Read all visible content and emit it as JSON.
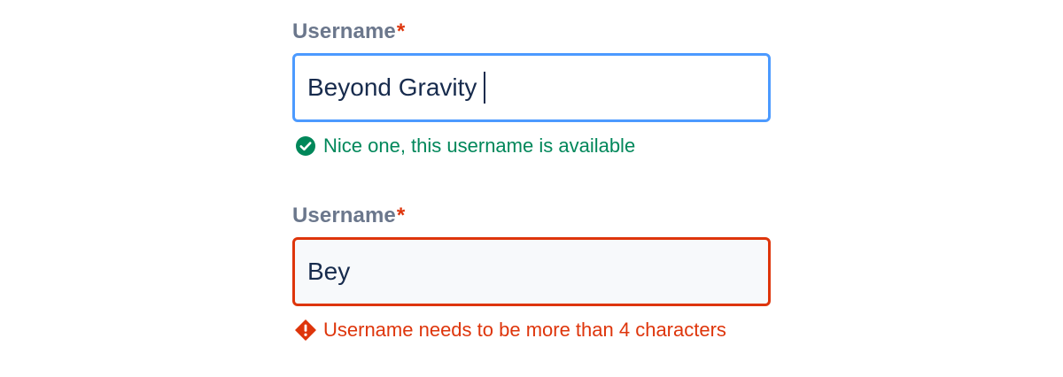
{
  "fields": [
    {
      "label": "Username",
      "required_marker": "*",
      "value": "Beyond Gravity",
      "state": "focused",
      "message": "Nice one, this username is available",
      "message_type": "success",
      "icon": "check-circle-icon"
    },
    {
      "label": "Username",
      "required_marker": "*",
      "value": "Bey",
      "state": "error",
      "message": "Username needs to be more than 4 characters",
      "message_type": "error",
      "icon": "error-diamond-icon"
    }
  ],
  "colors": {
    "label": "#6b778c",
    "required": "#de350b",
    "text": "#172b4d",
    "focus_border": "#4c9aff",
    "error_border": "#de350b",
    "error_input_bg": "#f7f9fb",
    "success": "#00875a",
    "error": "#de350b"
  }
}
